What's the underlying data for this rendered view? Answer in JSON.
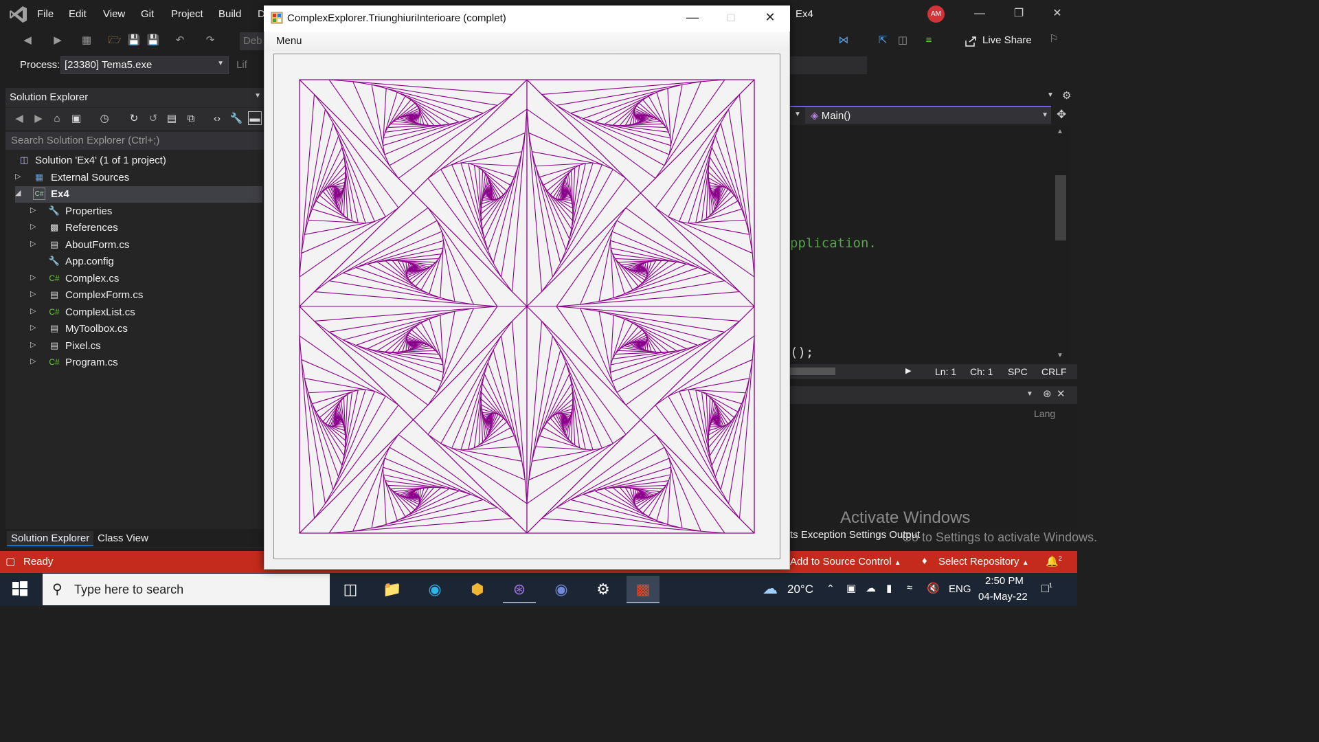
{
  "vs": {
    "menu": [
      "File",
      "Edit",
      "View",
      "Git",
      "Project",
      "Build",
      "D"
    ],
    "window_title": "Ex4",
    "avatar_initials": "AM",
    "live_share": "Live Share",
    "process_label": "Process:",
    "process_value": "[23380] Tema5.exe",
    "debug_hint": "Deb",
    "lifecycle_hint": "Lif"
  },
  "solution_explorer": {
    "title": "Solution Explorer",
    "search_placeholder": "Search Solution Explorer (Ctrl+;)",
    "solution_label": "Solution 'Ex4' (1 of 1 project)",
    "external_sources": "External Sources",
    "project": "Ex4",
    "items": [
      {
        "label": "Properties",
        "icon": "wrench-icon"
      },
      {
        "label": "References",
        "icon": "references-icon"
      },
      {
        "label": "AboutForm.cs",
        "icon": "form-icon"
      },
      {
        "label": "App.config",
        "icon": "config-icon"
      },
      {
        "label": "Complex.cs",
        "icon": "csharp-icon"
      },
      {
        "label": "ComplexForm.cs",
        "icon": "form-icon"
      },
      {
        "label": "ComplexList.cs",
        "icon": "csharp-icon"
      },
      {
        "label": "MyToolbox.cs",
        "icon": "form-icon"
      },
      {
        "label": "Pixel.cs",
        "icon": "form-icon"
      },
      {
        "label": "Program.cs",
        "icon": "csharp-icon"
      }
    ],
    "tabs": [
      "Solution Explorer",
      "Class View"
    ]
  },
  "editor": {
    "member_dropdown": "Main()",
    "code_fragment_1": "pplication.",
    "code_fragment_2": "();",
    "status": {
      "line": "Ln: 1",
      "char": "Ch: 1",
      "spc": "SPC",
      "crlf": "CRLF"
    }
  },
  "output": {
    "lang": "Lang",
    "tabs_text": "ts   Exception Settings   Output"
  },
  "watermark": {
    "line1": "Activate Windows",
    "line2": "Go to Settings to activate Windows."
  },
  "statusbar": {
    "ready": "Ready",
    "add_source": "Add to Source Control",
    "select_repo": "Select Repository",
    "notifications": "2"
  },
  "taskbar": {
    "search_placeholder": "Type here to search",
    "temperature": "20°C",
    "language": "ENG",
    "time": "2:50 PM",
    "date": "04-May-22",
    "notification_count": "1"
  },
  "form": {
    "title": "ComplexExplorer.TriunghiuriInterioare (complet)",
    "menu": "Menu",
    "line_color": "#8b008b"
  },
  "colors": {
    "vs_accent": "#7160e8",
    "statusbar": "#c42b1c",
    "avatar": "#d13438"
  }
}
